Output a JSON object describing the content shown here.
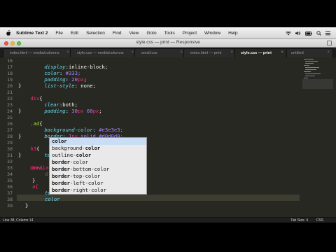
{
  "macbar": {
    "app": "Sublime Text 2",
    "menus": [
      "File",
      "Edit",
      "Selection",
      "Find",
      "View",
      "Goto",
      "Tools",
      "Project",
      "Window",
      "Help"
    ]
  },
  "titlebar": {
    "title": "style.css — print — Responsive"
  },
  "tabs": [
    {
      "label": "index.html — media/columns"
    },
    {
      "label": "style.css — media/columns"
    },
    {
      "label": "small.css"
    },
    {
      "label": "index.html — print"
    },
    {
      "label": "style.css — print"
    },
    {
      "label": "untitled"
    }
  ],
  "lines": [
    {
      "n": "16"
    },
    {
      "n": "17"
    },
    {
      "n": "18"
    },
    {
      "n": "19"
    },
    {
      "n": "20"
    },
    {
      "n": "21"
    },
    {
      "n": "22"
    },
    {
      "n": "23"
    },
    {
      "n": "24"
    },
    {
      "n": "25"
    },
    {
      "n": "26"
    },
    {
      "n": "27"
    },
    {
      "n": "28"
    },
    {
      "n": "29"
    },
    {
      "n": "30"
    },
    {
      "n": "31"
    },
    {
      "n": "32"
    },
    {
      "n": "33"
    },
    {
      "n": "34"
    },
    {
      "n": "35"
    },
    {
      "n": "36"
    },
    {
      "n": "37"
    },
    {
      "n": "38"
    },
    {
      "n": "39"
    }
  ],
  "code": {
    "l16_prop": "display",
    "l16_val": "inline-block;",
    "l17_prop": "color",
    "l17_val": "#333;",
    "l18_prop": "padding",
    "l18_num": "20",
    "l18_unit": "px",
    "l18_end": ";",
    "l19_prop": "list-style",
    "l19_val": "none;",
    "l20": "}",
    "l21_sel": "div",
    "l21_brace": "{",
    "l22_prop": "clear",
    "l22_val": "both;",
    "l23_prop": "padding",
    "l23_num1": "30",
    "l23_unit1": "px",
    "l23_num2": "60",
    "l23_unit2": "px",
    "l23_end": ";",
    "l24": "}",
    "l25_sel": ".ad",
    "l25_brace": "{",
    "l26_prop": "background-color",
    "l26_val": "#e3e3e3;",
    "l27_prop": "border",
    "l27_num": "1",
    "l27_unit": "px",
    "l27_val": "solid #d0d0d0;",
    "l28": "}",
    "l29_sel": "h3",
    "l29_brace": "{",
    "l30_prop": "text-",
    "l31": "}",
    "l32_kw": "@media",
    "l32_rest": "pr",
    "l33": "nav,",
    "l34": "d",
    "l35": "}",
    "l36": "a{",
    "l37": "te",
    "l38": "color",
    "l39": "}"
  },
  "autocomplete": [
    {
      "pre": "",
      "bold": "color",
      "post": ""
    },
    {
      "pre": "background-",
      "bold": "color",
      "post": ""
    },
    {
      "pre": "outline-",
      "bold": "color",
      "post": ""
    },
    {
      "pre": "",
      "bold": "border",
      "post": "-color"
    },
    {
      "pre": "",
      "bold": "border",
      "post": "-bottom-color"
    },
    {
      "pre": "",
      "bold": "border",
      "post": "-top-color"
    },
    {
      "pre": "",
      "bold": "border",
      "post": "-left-color"
    },
    {
      "pre": "",
      "bold": "border",
      "post": "-right-color"
    }
  ],
  "statusbar": {
    "position": "Line 38, Column 14",
    "tab_size": "Tab Size: 4",
    "syntax": "CSS"
  },
  "colors": {
    "editor_bg": "#272822",
    "keyword": "#f92672",
    "property": "#66d9ef",
    "number": "#ae81ff",
    "selector": "#a6e22e"
  }
}
